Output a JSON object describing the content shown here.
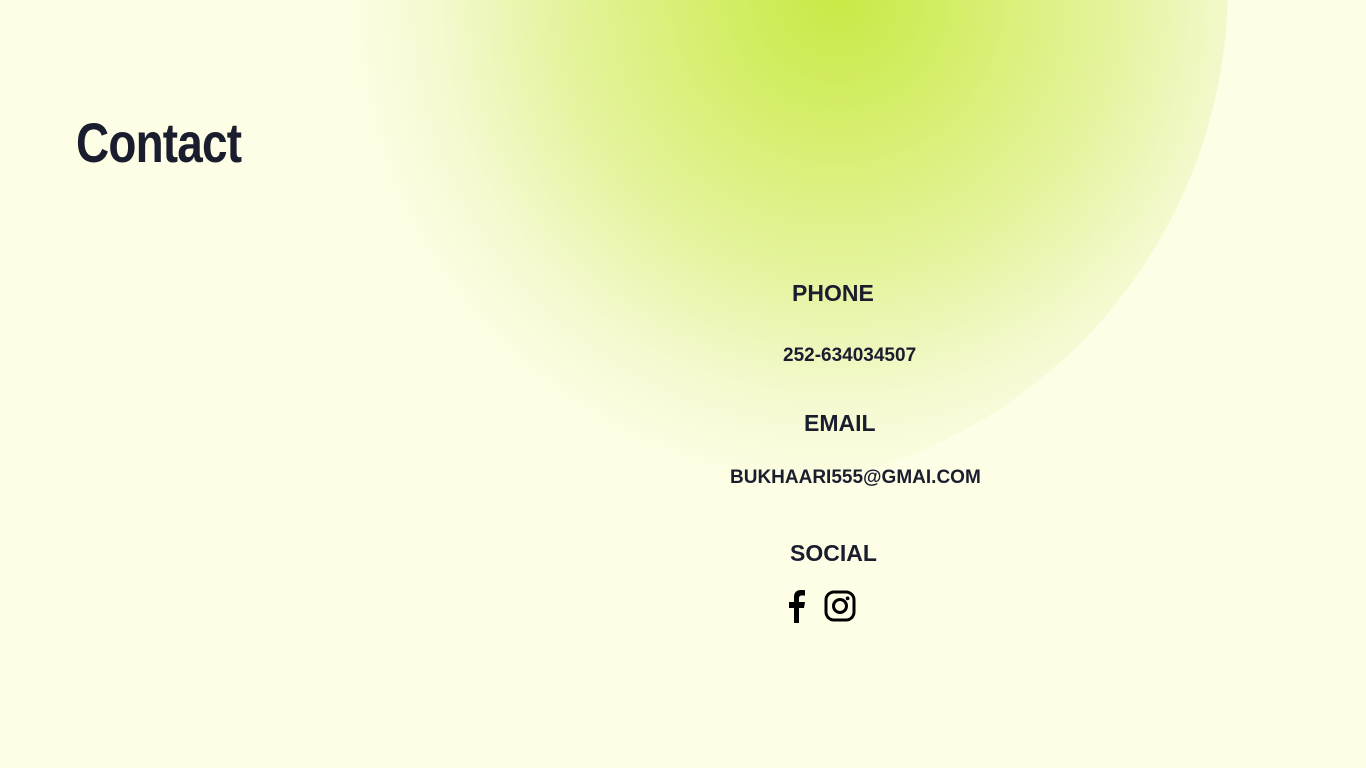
{
  "page": {
    "title": "Contact",
    "background_color": "#fefee6",
    "accent_color": "#c8e945",
    "text_color": "#1a1d2e"
  },
  "contact": {
    "phone_label": "PHONE",
    "phone_value": "252-634034507",
    "email_label": "EMAIL",
    "email_value": "BUKHAARI555@GMAI.COM",
    "social_label": "SOCIAL",
    "social_icons": [
      "facebook-icon",
      "instagram-icon"
    ]
  }
}
